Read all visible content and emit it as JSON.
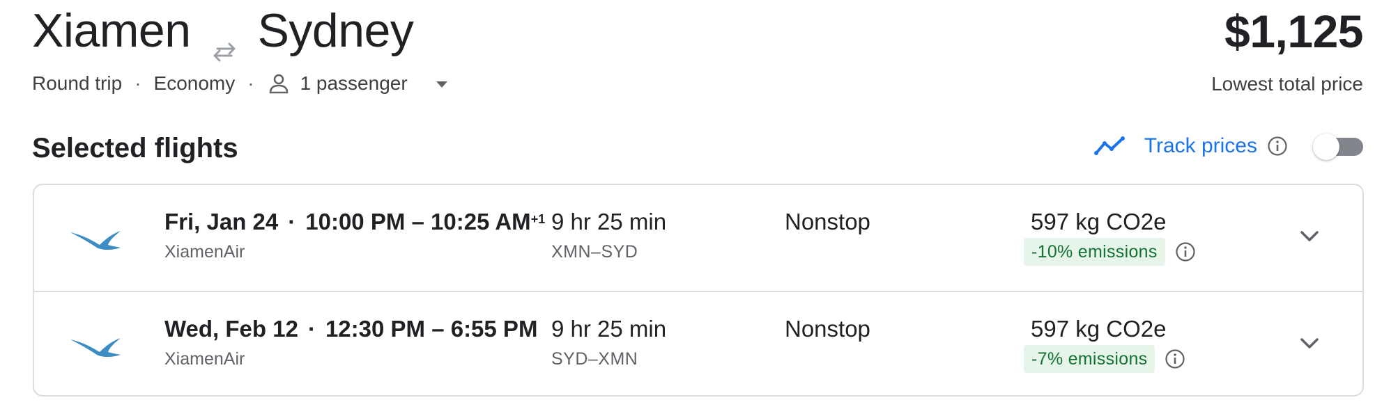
{
  "header": {
    "origin": "Xiamen",
    "destination": "Sydney",
    "swap_icon": "swap-arrows-icon",
    "trip_type": "Round trip",
    "cabin_class": "Economy",
    "passengers": "1 passenger",
    "separator": "·"
  },
  "price": {
    "amount": "$1,125",
    "caption": "Lowest total price"
  },
  "section": {
    "title": "Selected flights"
  },
  "track_prices": {
    "label": "Track prices",
    "enabled": false,
    "icon": "trending-line-icon",
    "accent": "#1a73e8"
  },
  "flights": [
    {
      "date": "Fri, Jan 24",
      "time_range": "10:00 PM – 10:25 AM",
      "day_offset": "+1",
      "airline": "XiamenAir",
      "duration": "9 hr 25 min",
      "route": "XMN–SYD",
      "stops": "Nonstop",
      "co2": "597 kg CO2e",
      "emissions_delta": "-10% emissions"
    },
    {
      "date": "Wed, Feb 12",
      "time_range": "12:30 PM – 6:55 PM",
      "day_offset": "",
      "airline": "XiamenAir",
      "duration": "9 hr 25 min",
      "route": "SYD–XMN",
      "stops": "Nonstop",
      "co2": "597 kg CO2e",
      "emissions_delta": "-7% emissions"
    }
  ],
  "colors": {
    "badge_bg": "#e6f4ea",
    "badge_text": "#137333",
    "logo_blue": "#3d8cc4"
  }
}
